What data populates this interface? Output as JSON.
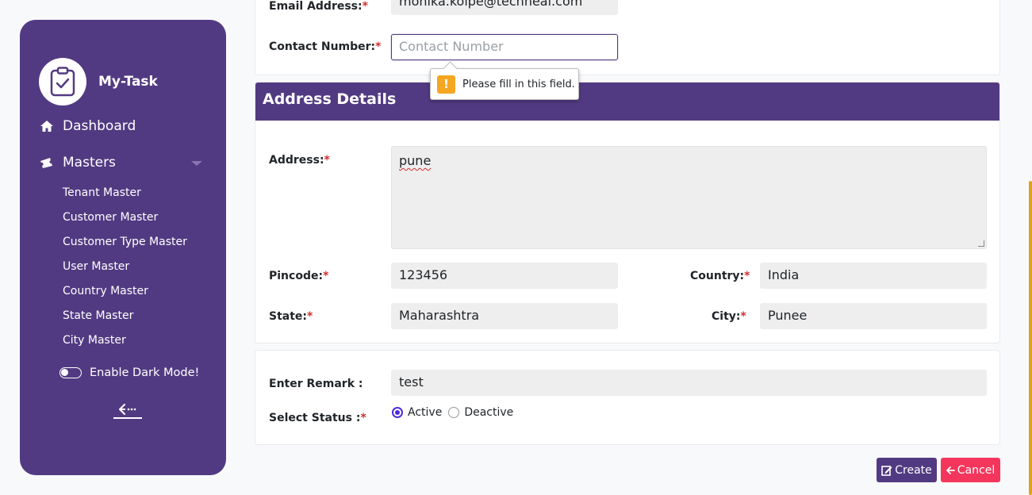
{
  "app": {
    "name": "My-Task"
  },
  "sidebar": {
    "dashboard_label": "Dashboard",
    "masters_label": "Masters",
    "submenu": [
      "Tenant Master",
      "Customer Master",
      "Customer Type Master",
      "User Master",
      "Country Master",
      "State Master",
      "City Master"
    ],
    "dark_mode_label": "Enable Dark Mode!",
    "dark_mode_on": false
  },
  "contact": {
    "email_label": "Email Address:",
    "email_value": "monika.kolpe@techneai.com",
    "phone_label": "Contact Number:",
    "phone_value": "",
    "phone_placeholder": "Contact Number"
  },
  "validation": {
    "message": "Please fill in this field."
  },
  "address": {
    "section_title": "Address Details",
    "address_label": "Address:",
    "address_value": "pune",
    "pincode_label": "Pincode:",
    "pincode_value": "123456",
    "country_label": "Country:",
    "country_value": "India",
    "state_label": "State:",
    "state_value": "Maharashtra",
    "city_label": "City:",
    "city_value": "Punee"
  },
  "remark": {
    "label": "Enter Remark :",
    "value": "test",
    "status_label": "Select Status :",
    "options": [
      "Active",
      "Deactive"
    ],
    "selected": "Active"
  },
  "actions": {
    "create_label": "Create",
    "cancel_label": "Cancel"
  },
  "required_marker": "*",
  "colors": {
    "brand": "#523a82",
    "required": "#d32f2f",
    "cancel": "#f5365c",
    "warning": "#f5a623",
    "scrollbar": "#e0a11b"
  }
}
